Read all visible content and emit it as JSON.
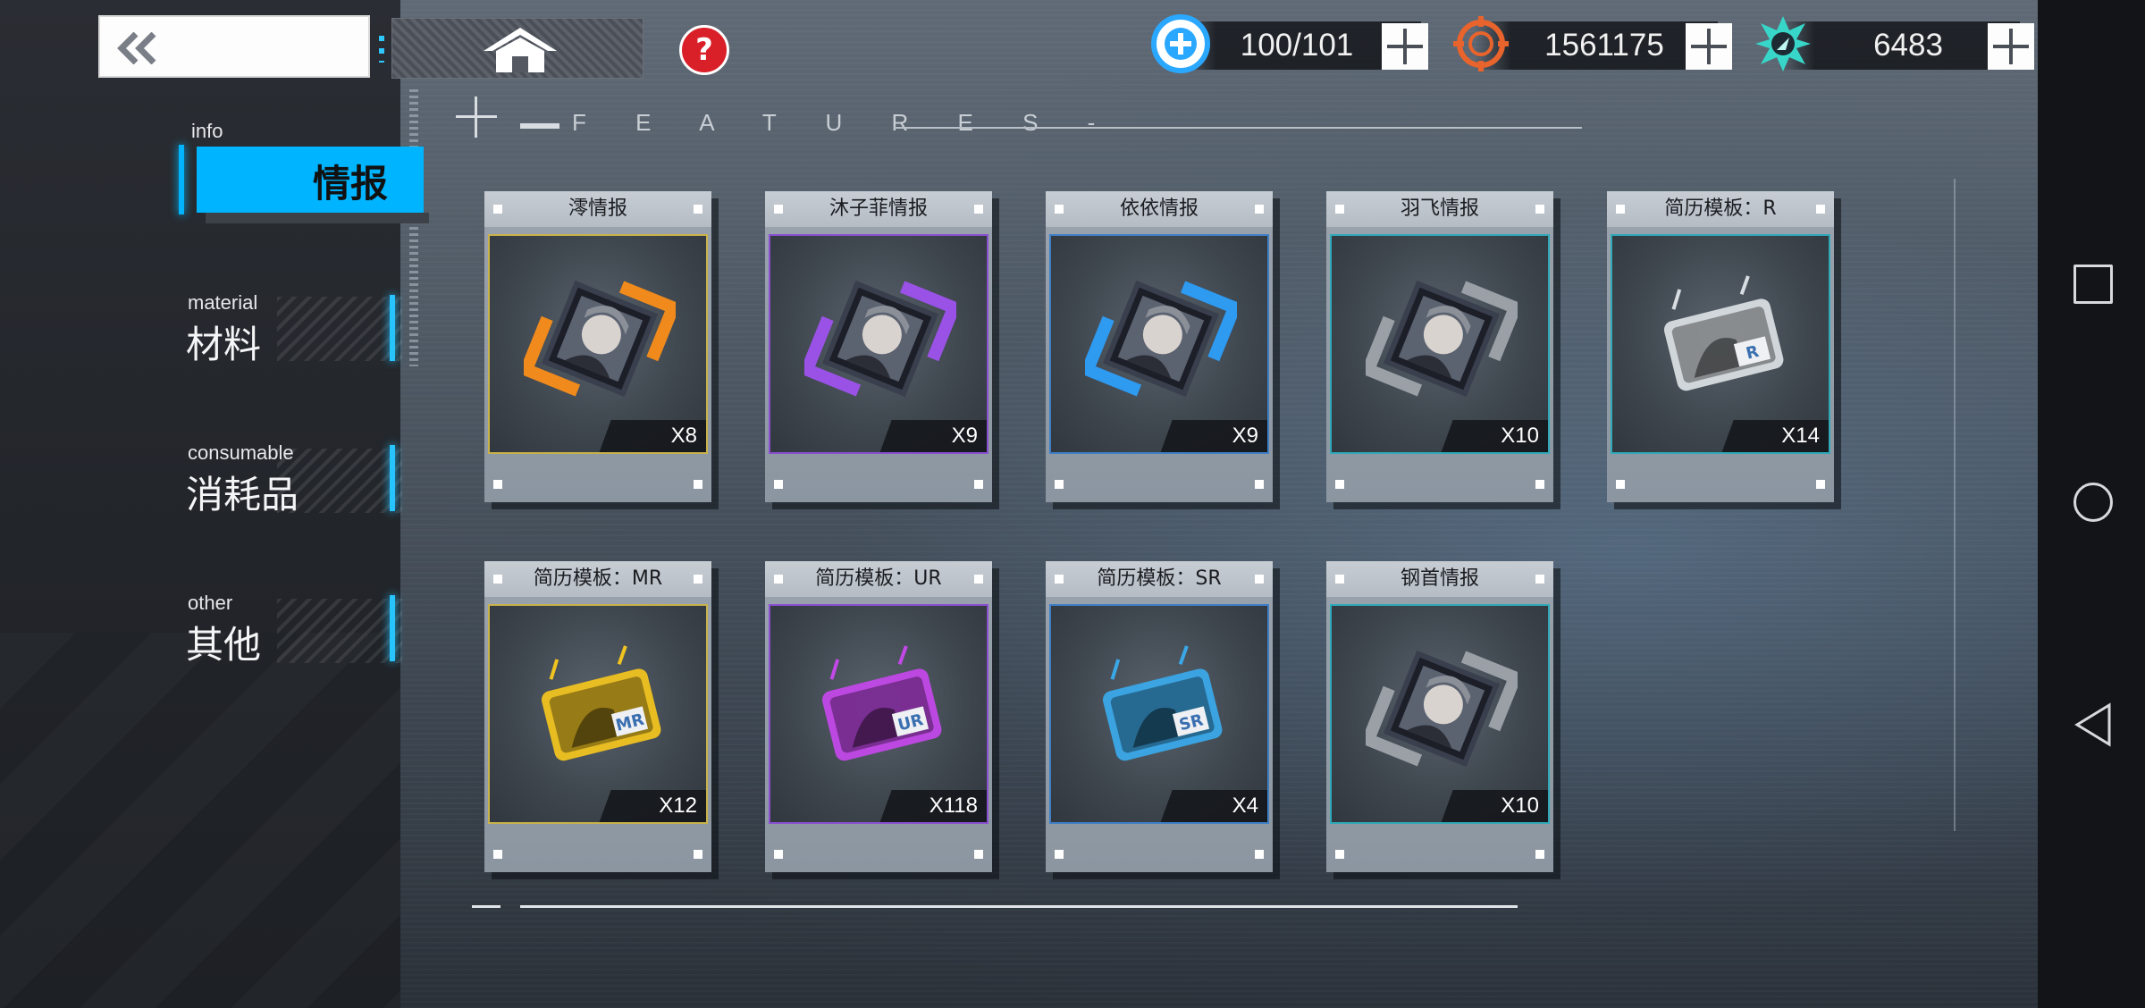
{
  "topbar": {
    "back_icon": "double-chevron-left-icon",
    "home_icon": "home-icon",
    "help_icon": "question-icon",
    "help_glyph": "?",
    "resources": [
      {
        "icon": "stamina-plus-icon",
        "value": "100/101",
        "color": "#2aa7ff"
      },
      {
        "icon": "coin-target-icon",
        "value": "1561175",
        "color": "#e8642c"
      },
      {
        "icon": "energy-crystal-icon",
        "value": "6483",
        "color": "#37d6c9"
      }
    ]
  },
  "header": {
    "features_label": "F E A T U R E S -"
  },
  "sidebar": {
    "tabs": [
      {
        "en": "info",
        "cn": "情报",
        "active": true
      },
      {
        "en": "material",
        "cn": "材料",
        "active": false
      },
      {
        "en": "consumable",
        "cn": "消耗品",
        "active": false
      },
      {
        "en": "other",
        "cn": "其他",
        "active": false
      }
    ]
  },
  "items": [
    {
      "name": "澪情报",
      "count": "X8",
      "rarity_color": "#c9b24a",
      "accent": "#f08a1c",
      "kind": "dossier"
    },
    {
      "name": "沐子菲情报",
      "count": "X9",
      "rarity_color": "#8a4fd0",
      "accent": "#9a52e6",
      "kind": "dossier"
    },
    {
      "name": "依依情报",
      "count": "X9",
      "rarity_color": "#3e7fc6",
      "accent": "#2e9af0",
      "kind": "dossier"
    },
    {
      "name": "羽飞情报",
      "count": "X10",
      "rarity_color": "#2fa9b8",
      "accent": "#9aa0a6",
      "kind": "dossier"
    },
    {
      "name": "简历模板：R",
      "count": "X14",
      "rarity_color": "#2fa9b8",
      "accent": "#d8dde2",
      "kind": "template",
      "badge": "R"
    },
    {
      "name": "简历模板：MR",
      "count": "X12",
      "rarity_color": "#c9b24a",
      "accent": "#f0c320",
      "kind": "template",
      "badge": "MR"
    },
    {
      "name": "简历模板：UR",
      "count": "X118",
      "rarity_color": "#8a4fd0",
      "accent": "#c248e8",
      "kind": "template",
      "badge": "UR"
    },
    {
      "name": "简历模板：SR",
      "count": "X4",
      "rarity_color": "#3e7fc6",
      "accent": "#3aa8e8",
      "kind": "template",
      "badge": "SR"
    },
    {
      "name": "钢首情报",
      "count": "X10",
      "rarity_color": "#2fa9b8",
      "accent": "#9aa0a6",
      "kind": "dossier"
    }
  ]
}
